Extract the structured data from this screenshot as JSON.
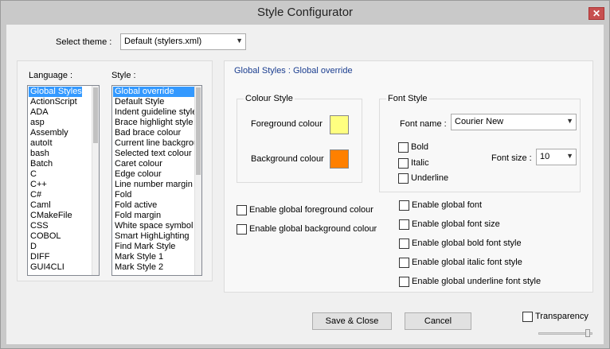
{
  "window": {
    "title": "Style Configurator",
    "close_glyph": "✕"
  },
  "theme": {
    "label": "Select theme :",
    "value": "Default (stylers.xml)"
  },
  "language": {
    "label": "Language :",
    "items": [
      "Global Styles",
      "ActionScript",
      "ADA",
      "asp",
      "Assembly",
      "autoIt",
      "bash",
      "Batch",
      "C",
      "C++",
      "C#",
      "Caml",
      "CMakeFile",
      "CSS",
      "COBOL",
      "D",
      "DIFF",
      "GUI4CLI"
    ],
    "selected": 0
  },
  "style": {
    "label": "Style :",
    "items": [
      "Global override",
      "Default Style",
      "Indent guideline style",
      "Brace highlight style",
      "Bad brace colour",
      "Current line background",
      "Selected text colour",
      "Caret colour",
      "Edge colour",
      "Line number margin",
      "Fold",
      "Fold active",
      "Fold margin",
      "White space symbol",
      "Smart HighLighting",
      "Find Mark Style",
      "Mark Style 1",
      "Mark Style 2"
    ],
    "selected": 0
  },
  "heading": "Global Styles : Global override",
  "colour_style": {
    "title": "Colour Style",
    "foreground_label": "Foreground colour",
    "background_label": "Background colour",
    "foreground_color": "#ffff80",
    "background_color": "#ff8000"
  },
  "font_style": {
    "title": "Font Style",
    "name_label": "Font name :",
    "name_value": "Courier New",
    "size_label": "Font size :",
    "size_value": "10",
    "bold": "Bold",
    "italic": "Italic",
    "underline": "Underline"
  },
  "global_checks": {
    "fg": "Enable global foreground colour",
    "bg": "Enable global background colour",
    "font": "Enable global font",
    "font_size": "Enable global font size",
    "bold": "Enable global bold font style",
    "italic": "Enable global italic font style",
    "underline": "Enable global underline font style"
  },
  "buttons": {
    "save": "Save & Close",
    "cancel": "Cancel"
  },
  "transparency": {
    "label": "Transparency",
    "value": 0.95
  },
  "accent": {
    "selection": "#3399ff",
    "heading": "#1a3d8f",
    "close": "#c75050"
  },
  "icons": {
    "dropdown": "chevron-down-icon",
    "close": "close-icon"
  }
}
